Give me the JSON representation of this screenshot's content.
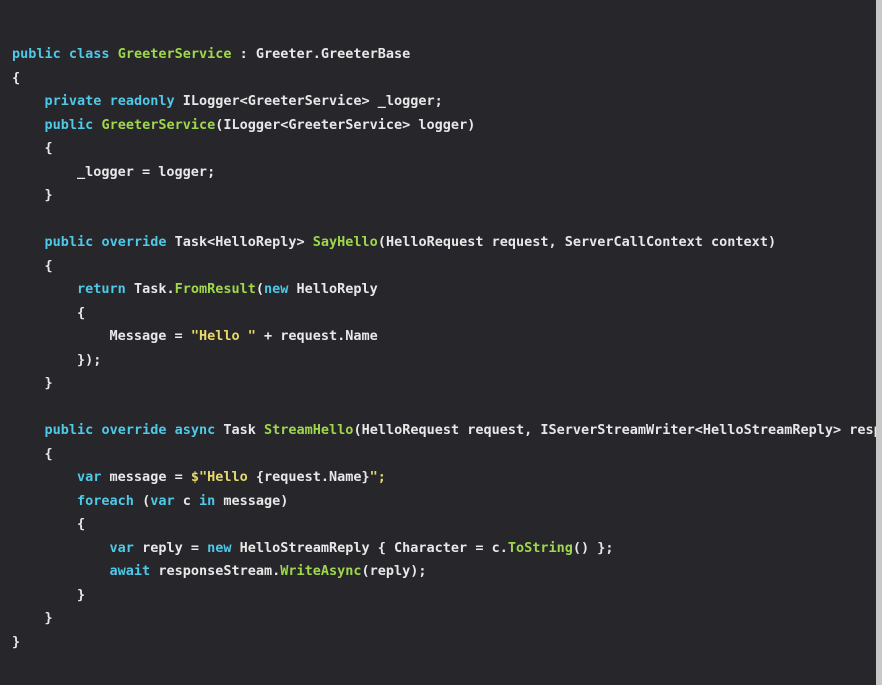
{
  "editor": {
    "language": "C#",
    "background_color": "#26262b",
    "right_edge_color": "#c8c8c8",
    "colors": {
      "keyword": "#4ec9e8",
      "method": "#9fd84a",
      "plain": "#e8e8e8",
      "string": "#e8d96a"
    }
  },
  "code": {
    "lines": [
      [
        {
          "t": "public",
          "c": "kw"
        },
        {
          "t": " ",
          "c": "pl"
        },
        {
          "t": "class",
          "c": "kw"
        },
        {
          "t": " ",
          "c": "pl"
        },
        {
          "t": "GreeterService",
          "c": "fn"
        },
        {
          "t": " : Greeter.GreeterBase",
          "c": "pl"
        }
      ],
      [
        {
          "t": "{",
          "c": "pl"
        }
      ],
      [
        {
          "t": "    ",
          "c": "pl"
        },
        {
          "t": "private",
          "c": "kw"
        },
        {
          "t": " ",
          "c": "pl"
        },
        {
          "t": "readonly",
          "c": "kw"
        },
        {
          "t": " ILogger<GreeterService> _logger;",
          "c": "pl"
        }
      ],
      [
        {
          "t": "    ",
          "c": "pl"
        },
        {
          "t": "public",
          "c": "kw"
        },
        {
          "t": " ",
          "c": "pl"
        },
        {
          "t": "GreeterService",
          "c": "fn"
        },
        {
          "t": "(ILogger<GreeterService> logger)",
          "c": "pl"
        }
      ],
      [
        {
          "t": "    {",
          "c": "pl"
        }
      ],
      [
        {
          "t": "        _logger = logger;",
          "c": "pl"
        }
      ],
      [
        {
          "t": "    }",
          "c": "pl"
        }
      ],
      [],
      [
        {
          "t": "    ",
          "c": "pl"
        },
        {
          "t": "public",
          "c": "kw"
        },
        {
          "t": " ",
          "c": "pl"
        },
        {
          "t": "override",
          "c": "kw"
        },
        {
          "t": " Task<HelloReply> ",
          "c": "pl"
        },
        {
          "t": "SayHello",
          "c": "fn"
        },
        {
          "t": "(HelloRequest request, ServerCallContext context)",
          "c": "pl"
        }
      ],
      [
        {
          "t": "    {",
          "c": "pl"
        }
      ],
      [
        {
          "t": "        ",
          "c": "pl"
        },
        {
          "t": "return",
          "c": "kw"
        },
        {
          "t": " Task.",
          "c": "pl"
        },
        {
          "t": "FromResult",
          "c": "fn"
        },
        {
          "t": "(",
          "c": "pl"
        },
        {
          "t": "new",
          "c": "kw"
        },
        {
          "t": " HelloReply",
          "c": "pl"
        }
      ],
      [
        {
          "t": "        {",
          "c": "pl"
        }
      ],
      [
        {
          "t": "            Message = ",
          "c": "pl"
        },
        {
          "t": "\"Hello \"",
          "c": "str"
        },
        {
          "t": " + request.Name",
          "c": "pl"
        }
      ],
      [
        {
          "t": "        });",
          "c": "pl"
        }
      ],
      [
        {
          "t": "    }",
          "c": "pl"
        }
      ],
      [],
      [
        {
          "t": "    ",
          "c": "pl"
        },
        {
          "t": "public",
          "c": "kw"
        },
        {
          "t": " ",
          "c": "pl"
        },
        {
          "t": "override",
          "c": "kw"
        },
        {
          "t": " ",
          "c": "pl"
        },
        {
          "t": "async",
          "c": "kw"
        },
        {
          "t": " Task ",
          "c": "pl"
        },
        {
          "t": "StreamHello",
          "c": "fn"
        },
        {
          "t": "(HelloRequest request, IServerStreamWriter<HelloStreamReply> responseStream, ServerCallContext context)",
          "c": "pl"
        }
      ],
      [
        {
          "t": "    {",
          "c": "pl"
        }
      ],
      [
        {
          "t": "        ",
          "c": "pl"
        },
        {
          "t": "var",
          "c": "kw"
        },
        {
          "t": " message = ",
          "c": "pl"
        },
        {
          "t": "$\"Hello ",
          "c": "str"
        },
        {
          "t": "{request.Name}",
          "c": "pl"
        },
        {
          "t": "\";",
          "c": "str"
        }
      ],
      [
        {
          "t": "        ",
          "c": "pl"
        },
        {
          "t": "foreach",
          "c": "kw"
        },
        {
          "t": " (",
          "c": "pl"
        },
        {
          "t": "var",
          "c": "kw"
        },
        {
          "t": " c ",
          "c": "pl"
        },
        {
          "t": "in",
          "c": "kw"
        },
        {
          "t": " message)",
          "c": "pl"
        }
      ],
      [
        {
          "t": "        {",
          "c": "pl"
        }
      ],
      [
        {
          "t": "            ",
          "c": "pl"
        },
        {
          "t": "var",
          "c": "kw"
        },
        {
          "t": " reply = ",
          "c": "pl"
        },
        {
          "t": "new",
          "c": "kw"
        },
        {
          "t": " HelloStreamReply { Character = c.",
          "c": "pl"
        },
        {
          "t": "ToString",
          "c": "fn"
        },
        {
          "t": "() };",
          "c": "pl"
        }
      ],
      [
        {
          "t": "            ",
          "c": "pl"
        },
        {
          "t": "await",
          "c": "kw"
        },
        {
          "t": " responseStream.",
          "c": "pl"
        },
        {
          "t": "WriteAsync",
          "c": "fn"
        },
        {
          "t": "(reply);",
          "c": "pl"
        }
      ],
      [
        {
          "t": "        }",
          "c": "pl"
        }
      ],
      [
        {
          "t": "    }",
          "c": "pl"
        }
      ],
      [
        {
          "t": "}",
          "c": "pl"
        }
      ]
    ]
  }
}
